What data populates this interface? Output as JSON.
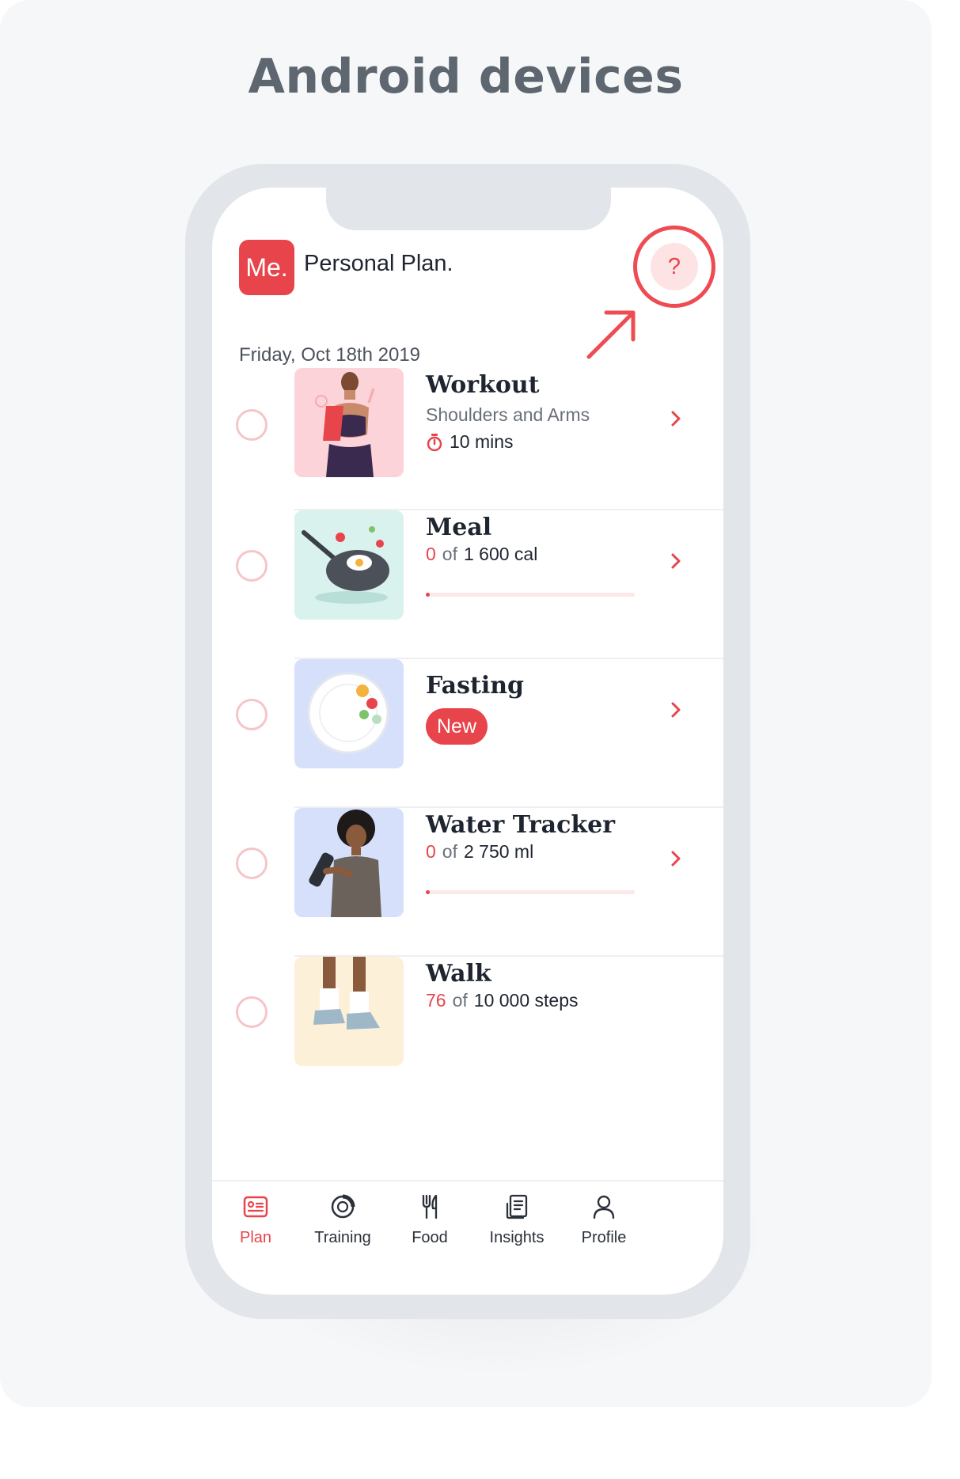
{
  "heading": "Android devices",
  "app": {
    "logo_text": "Me.",
    "title": "Personal Plan.",
    "help_label": "?",
    "date": "Friday, Oct 18th 2019"
  },
  "plan_items": [
    {
      "title": "Workout",
      "subtitle": "Shoulders and Arms",
      "duration": "10 mins"
    },
    {
      "title": "Meal",
      "current": "0",
      "of": "of",
      "target": "1 600 cal",
      "progress": 0.01
    },
    {
      "title": "Fasting",
      "badge": "New"
    },
    {
      "title": "Water Tracker",
      "current": "0",
      "of": "of",
      "target": "2 750 ml",
      "progress": 0.01
    },
    {
      "title": "Walk",
      "current": "76",
      "of": "of",
      "target": "10 000 steps"
    }
  ],
  "tabs": [
    {
      "label": "Plan",
      "icon": "plan-icon",
      "active": true
    },
    {
      "label": "Training",
      "icon": "training-icon"
    },
    {
      "label": "Food",
      "icon": "food-icon"
    },
    {
      "label": "Insights",
      "icon": "insights-icon"
    },
    {
      "label": "Profile",
      "icon": "profile-icon"
    }
  ],
  "colors": {
    "accent": "#e8444b",
    "text": "#1f2530",
    "muted": "#6a707a",
    "card_bg": "#f6f7f9",
    "phone_frame": "#e2e5e9"
  }
}
